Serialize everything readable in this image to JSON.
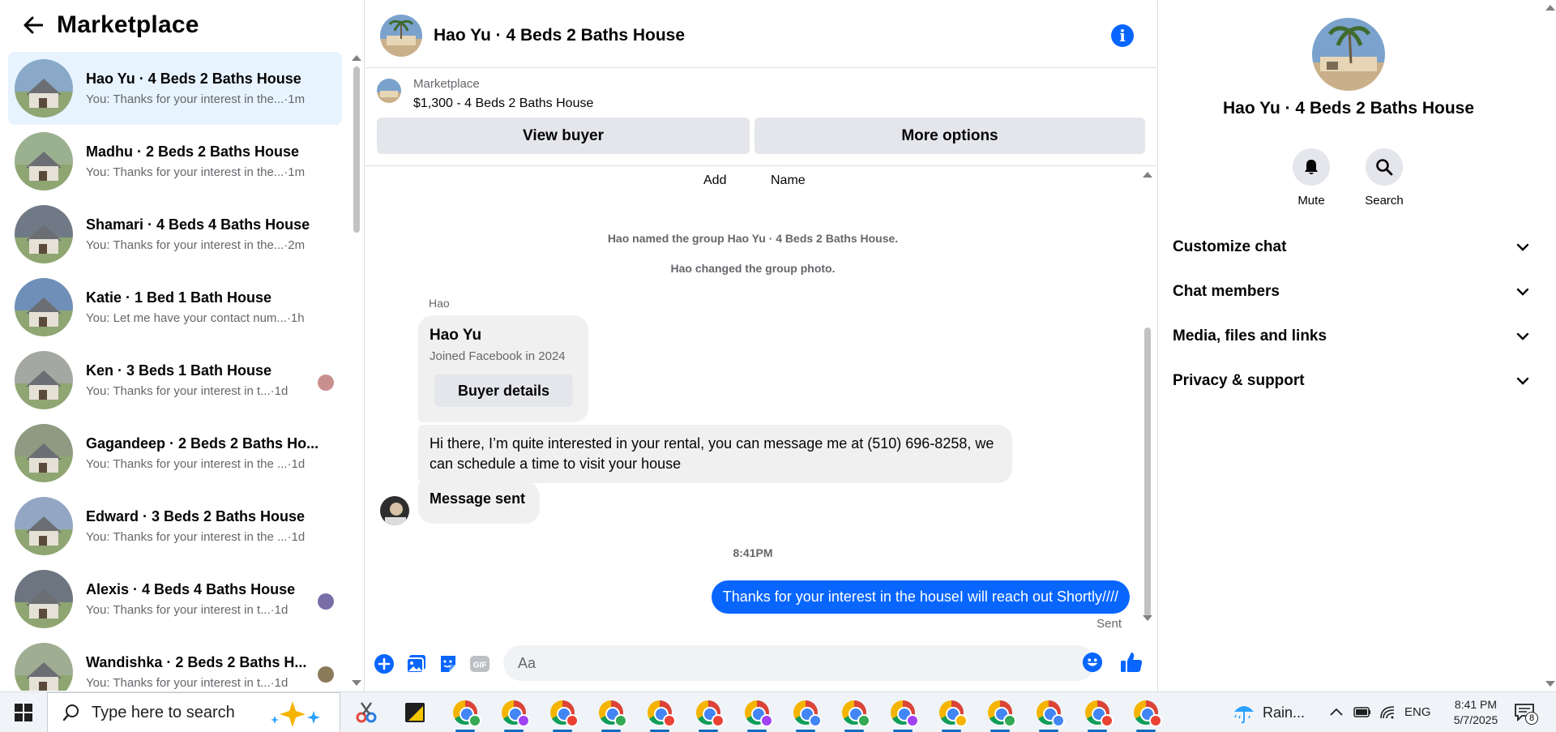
{
  "sidebar": {
    "title": "Marketplace",
    "conversations": [
      {
        "name": "Hao Yu · 4 Beds 2 Baths House",
        "preview": "You: Thanks for your interest in the...",
        "time": "·1m",
        "active": true,
        "thumb_color": "#8aa9c9"
      },
      {
        "name": "Madhu · 2 Beds 2 Baths House",
        "preview": "You: Thanks for your interest in the...",
        "time": "·1m",
        "thumb_color": "#9bb08f"
      },
      {
        "name": "Shamari · 4 Beds 4 Baths House",
        "preview": "You: Thanks for your interest in the...",
        "time": "·2m",
        "thumb_color": "#707a86"
      },
      {
        "name": "Katie · 1 Bed 1 Bath House",
        "preview": "You: Let me have your contact num...",
        "time": "·1h",
        "thumb_color": "#6f8fb8"
      },
      {
        "name": "Ken · 3 Beds 1 Bath House",
        "preview": "You: Thanks for your interest in t...",
        "time": "·1d",
        "thumb_color": "#a5a8a2"
      },
      {
        "name": "Gagandeep · 2 Beds 2 Baths Ho...",
        "preview": "You: Thanks for your interest in the ...",
        "time": "·1d",
        "thumb_color": "#8e9b82"
      },
      {
        "name": "Edward · 3 Beds 2 Baths House",
        "preview": "You: Thanks for your interest in the ...",
        "time": "·1d",
        "thumb_color": "#93a7c4"
      },
      {
        "name": "Alexis · 4 Beds 4 Baths House",
        "preview": "You: Thanks for your interest in t...",
        "time": "·1d",
        "thumb_color": "#6d7580"
      },
      {
        "name": "Wandishka · 2 Beds 2 Baths H...",
        "preview": "You: Thanks for your interest in t...",
        "time": "·1d",
        "thumb_color": "#9fae93"
      }
    ]
  },
  "chat": {
    "title": "Hao Yu · 4 Beds 2 Baths House",
    "marketplace_label": "Marketplace",
    "listing": "$1,300 - 4 Beds 2 Baths House",
    "view_buyer": "View buyer",
    "more_options": "More options",
    "pinned_add": "Add",
    "pinned_name": "Name",
    "system_messages": [
      "Hao named the group Hao Yu · 4 Beds 2 Baths House.",
      "Hao changed the group photo."
    ],
    "sender": "Hao",
    "card_name": "Hao Yu",
    "card_sub": "Joined Facebook in 2024",
    "buyer_details": "Buyer details",
    "incoming_message": "Hi there, I’m quite interested in your rental, you can message me at (510) 696-8258, we can schedule a time to visit your house",
    "incoming_status": "Message sent",
    "timestamp": "8:41PM",
    "outgoing_message": "Thanks for your interest in the houseI will reach out Shortly////",
    "sent_label": "Sent",
    "input_placeholder": "Aa"
  },
  "details": {
    "title": "Hao Yu · 4 Beds 2 Baths House",
    "mute": "Mute",
    "search": "Search",
    "sections": [
      "Customize chat",
      "Chat members",
      "Media, files and links",
      "Privacy & support"
    ]
  },
  "taskbar": {
    "search_placeholder": "Type here to search",
    "weather": "Rain...",
    "language": "ENG",
    "time": "8:41 PM",
    "date": "5/7/2025",
    "notification_count": "8"
  },
  "colors": {
    "accent": "#0866ff",
    "active_row": "#e7f3ff",
    "bubble_in": "#f0f0f0"
  }
}
